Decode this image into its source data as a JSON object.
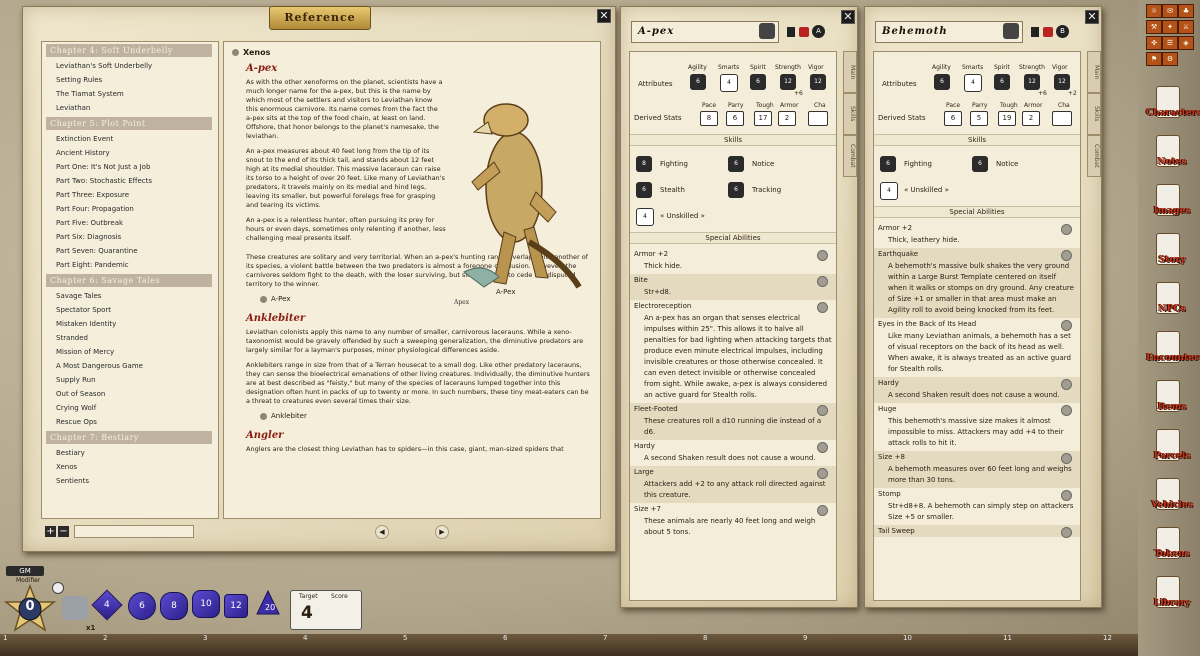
{
  "reference": {
    "title": "Reference",
    "toc": [
      {
        "type": "chapter",
        "label": "Chapter 4: Soft Underbelly"
      },
      {
        "type": "item",
        "label": "Leviathan's Soft Underbelly"
      },
      {
        "type": "item",
        "label": "Setting Rules"
      },
      {
        "type": "item",
        "label": "The Tiamat System"
      },
      {
        "type": "item",
        "label": "Leviathan"
      },
      {
        "type": "chapter",
        "label": "Chapter 5: Plot Point"
      },
      {
        "type": "item",
        "label": "Extinction Event"
      },
      {
        "type": "item",
        "label": "Ancient History"
      },
      {
        "type": "item",
        "label": "Part One: It's Not Just a Job"
      },
      {
        "type": "item",
        "label": "Part Two: Stochastic Effects"
      },
      {
        "type": "item",
        "label": "Part Three: Exposure"
      },
      {
        "type": "item",
        "label": "Part Four: Propagation"
      },
      {
        "type": "item",
        "label": "Part Five: Outbreak"
      },
      {
        "type": "item",
        "label": "Part Six: Diagnosis"
      },
      {
        "type": "item",
        "label": "Part Seven: Quarantine"
      },
      {
        "type": "item",
        "label": "Part Eight: Pandemic"
      },
      {
        "type": "chapter",
        "label": "Chapter 6: Savage Tales"
      },
      {
        "type": "item",
        "label": "Savage Tales"
      },
      {
        "type": "item",
        "label": "Spectator Sport"
      },
      {
        "type": "item",
        "label": "Mistaken Identity"
      },
      {
        "type": "item",
        "label": "Stranded"
      },
      {
        "type": "item",
        "label": "Mission of Mercy"
      },
      {
        "type": "item",
        "label": "A Most Dangerous Game"
      },
      {
        "type": "item",
        "label": "Supply Run"
      },
      {
        "type": "item",
        "label": "Out of Season"
      },
      {
        "type": "item",
        "label": "Crying Wolf"
      },
      {
        "type": "item",
        "label": "Rescue Ops"
      },
      {
        "type": "chapter",
        "label": "Chapter 7: Bestiary"
      },
      {
        "type": "item",
        "label": "Bestiary"
      },
      {
        "type": "item",
        "label": "Xenos"
      },
      {
        "type": "item",
        "label": "Sentients"
      }
    ],
    "content": {
      "section": "Xenos",
      "apex_heading": "A-pex",
      "apex_p1": "As with the other xenoforms on the planet, scientists have a much longer name for the a-pex, but this is the name by which most of the settlers and visitors to Leviathan know this enormous carnivore. Its name comes from the fact the a-pex sits at the top of the food chain, at least on land. Offshore, that honor belongs to the planet's namesake, the leviathan.",
      "apex_p2": "An a-pex measures about 40 feet long from the tip of its snout to the end of its thick tail, and stands about 12 feet high at its medial shoulder. This massive laceraun can raise its torso to a height of over 20 feet. Like many of Leviathan's predators, it travels mainly on its medial and hind legs, leaving its smaller, but powerful forelegs free for grasping and tearing its victims.",
      "apex_p3": "An a-pex is a relentless hunter, often pursuing its prey for hours or even days, sometimes only relenting if another, less challenging meal presents itself.",
      "apex_p4": "These creatures are solitary and very territorial. When an a-pex's hunting range overlaps with another of its species, a violent battle between the two predators is almost a foregone conclusion. However, the carnivores seldom fight to the death, with the loser surviving, but slinking away to cede the disputed territory to the winner.",
      "apex_link": "A-Pex",
      "apex_caption": "A-Pex",
      "ankle_heading": "Anklebiter",
      "ankle_p1": "Leviathan colonists apply this name to any number of smaller, carnivorous lacerauns. While a xeno-taxonomist would be gravely offended by such a sweeping generalization, the diminutive predators are largely similar for a layman's purposes, minor physiological differences aside.",
      "ankle_p2": "Anklebiters range in size from that of a Terran housecat to a small dog. Like other predatory lacerauns, they can sense the bioelectrical emanations of other living creatures. Individually, the diminutive hunters are at best described as \"feisty,\" but many of the species of lacerauns lumped together into this designation often hunt in packs of up to twenty or more. In such numbers, these tiny meat-eaters can be a threat to creatures even several times their size.",
      "ankle_link": "Anklebiter",
      "angler_heading": "Angler",
      "angler_p1": "Anglers are the closest thing Leviathan has to spiders—in this case, giant, man-sized spiders that"
    }
  },
  "apex": {
    "name": "A-pex",
    "attr_labels": [
      "Agility",
      "Smarts",
      "Spirit",
      "Strength",
      "Vigor"
    ],
    "attr_values": [
      "6",
      "4",
      "6",
      "12",
      "12"
    ],
    "strength_mod": "+6",
    "attributes_label": "Attributes",
    "derived_label": "Derived Stats",
    "derived_names": [
      "Pace",
      "Parry",
      "Tough",
      "Armor",
      "Cha"
    ],
    "derived_values": [
      "8",
      "6",
      "17",
      "2",
      ""
    ],
    "skills_header": "Skills",
    "skills": [
      "Fighting",
      "Notice",
      "Stealth",
      "Tracking",
      "« Unskilled »"
    ],
    "skill_dice": [
      "8",
      "6",
      "6",
      "6",
      "4"
    ],
    "special_header": "Special Abilities",
    "abilities": [
      {
        "name": "Armor +2",
        "desc": "Thick hide."
      },
      {
        "name": "Bite",
        "desc": "Str+d8."
      },
      {
        "name": "Electroreception",
        "desc": "An a-pex has an organ that senses electrical impulses within 25\". This allows it to halve all penalties for bad lighting when attacking targets that produce even minute electrical impulses, including invisible creatures or those otherwise concealed. It can even detect invisible or otherwise concealed from sight. While awake, a-pex is always considered an active guard for Stealth rolls."
      },
      {
        "name": "Fleet-Footed",
        "desc": "These creatures roll a d10 running die instead of a d6."
      },
      {
        "name": "Hardy",
        "desc": "A second Shaken result does not cause a wound."
      },
      {
        "name": "Large",
        "desc": "Attackers add +2 to any attack roll directed against this creature."
      },
      {
        "name": "Size +7",
        "desc": "These animals are nearly 40 feet long and weigh about 5 tons."
      }
    ]
  },
  "behemoth": {
    "name": "Behemoth",
    "attr_labels": [
      "Agility",
      "Smarts",
      "Spirit",
      "Strength",
      "Vigor"
    ],
    "attr_values": [
      "6",
      "4",
      "6",
      "12",
      "12"
    ],
    "strength_mod": "+6",
    "vigor_mod": "+2",
    "attributes_label": "Attributes",
    "derived_label": "Derived Stats",
    "derived_names": [
      "Pace",
      "Parry",
      "Tough",
      "Armor",
      "Cha"
    ],
    "derived_values": [
      "6",
      "5",
      "19",
      "2",
      ""
    ],
    "skills_header": "Skills",
    "skills": [
      "Fighting",
      "Notice",
      "« Unskilled »"
    ],
    "skill_dice": [
      "6",
      "6",
      "4"
    ],
    "special_header": "Special Abilities",
    "abilities": [
      {
        "name": "Armor +2",
        "desc": "Thick, leathery hide."
      },
      {
        "name": "Earthquake",
        "desc": "A behemoth's massive bulk shakes the very ground within a Large Burst Template centered on itself when it walks or stomps on dry ground. Any creature of Size +1 or smaller in that area must make an Agility roll to avoid being knocked from its feet."
      },
      {
        "name": "Eyes in the Back of Its Head",
        "desc": "Like many Leviathan animals, a behemoth has a set of visual receptors on the back of its head as well. When awake, it is always treated as an active guard for Stealth rolls."
      },
      {
        "name": "Hardy",
        "desc": "A second Shaken result does not cause a wound."
      },
      {
        "name": "Huge",
        "desc": "This behemoth's massive size makes it almost impossible to miss. Attackers may add +4 to their attack rolls to hit it."
      },
      {
        "name": "Size +8",
        "desc": "A behemoth measures over 60 feet long and weighs more than 30 tons."
      },
      {
        "name": "Stomp",
        "desc": "Str+d8+8. A behemoth can simply step on attackers Size +5 or smaller."
      },
      {
        "name": "Tail Sweep",
        "desc": ""
      }
    ]
  },
  "tabs": [
    "Main",
    "Skills",
    "Combat"
  ],
  "sidebar": {
    "buttons": [
      "Characters",
      "Notes",
      "Images",
      "Story",
      "NPCs",
      "Encounters",
      "Items",
      "Parcels",
      "Vehicles",
      "Tokens",
      "Library"
    ]
  },
  "dice": {
    "gm_label": "GM",
    "modifier_label": "Modifier",
    "modifier_value": "0",
    "multiplier": "x1",
    "die_labels": [
      "4",
      "6",
      "8",
      "10",
      "12",
      "20"
    ],
    "target_label": "Target",
    "score_label": "Score",
    "target_value": "4"
  },
  "ruler": [
    "1",
    "2",
    "3",
    "4",
    "5",
    "6",
    "7",
    "8",
    "9",
    "10",
    "11",
    "12"
  ]
}
